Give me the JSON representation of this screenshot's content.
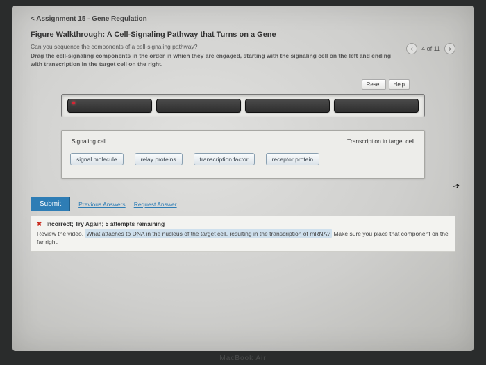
{
  "breadcrumb": "< Assignment 15 - Gene Regulation",
  "title": "Figure Walkthrough: A Cell-Signaling Pathway that Turns on a Gene",
  "prompt": "Can you sequence the components of a cell-signaling pathway?",
  "instructions": "Drag the cell-signaling components in the order in which they are engaged, starting with the signaling cell on the left and ending with transcription in the target cell on the right.",
  "nav": {
    "counter": "4 of 11"
  },
  "controls": {
    "reset": "Reset",
    "help": "Help"
  },
  "ends": {
    "left": "Signaling cell",
    "right": "Transcription in target cell"
  },
  "draggables": [
    "signal molecule",
    "relay proteins",
    "transcription factor",
    "receptor protein"
  ],
  "submit": {
    "label": "Submit",
    "previous": "Previous Answers",
    "request": "Request Answer"
  },
  "feedback": {
    "header": "Incorrect; Try Again; 5 attempts remaining",
    "prefix": "Review the video. ",
    "hint_q": "What attaches to DNA in the nucleus of the target cell, resulting in the transcription of mRNA?",
    "suffix": " Make sure you place that component on the far right."
  },
  "brand": "MacBook Air"
}
